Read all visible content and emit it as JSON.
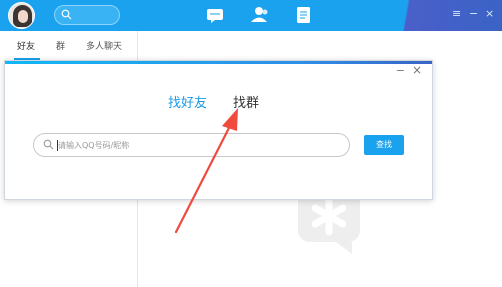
{
  "topbar": {
    "nav": [
      {
        "name": "messages-icon"
      },
      {
        "name": "contacts-icon"
      },
      {
        "name": "documents-icon"
      }
    ],
    "window_controls": {
      "settings": "≡",
      "minimize": "−",
      "close": "×"
    }
  },
  "sidebar": {
    "tabs": [
      {
        "label": "好友"
      },
      {
        "label": "群"
      },
      {
        "label": "多人聊天"
      }
    ]
  },
  "dialog": {
    "minimize": "−",
    "close": "×",
    "modes": [
      {
        "label": "找好友",
        "active": true
      },
      {
        "label": "找群",
        "active": false
      }
    ],
    "search_placeholder": "请输入QQ号码/昵称",
    "find_button": "查找"
  },
  "colors": {
    "accent": "#1aa2ef",
    "active_tab": "#1a9be8",
    "arrow": "#f04a3e"
  }
}
